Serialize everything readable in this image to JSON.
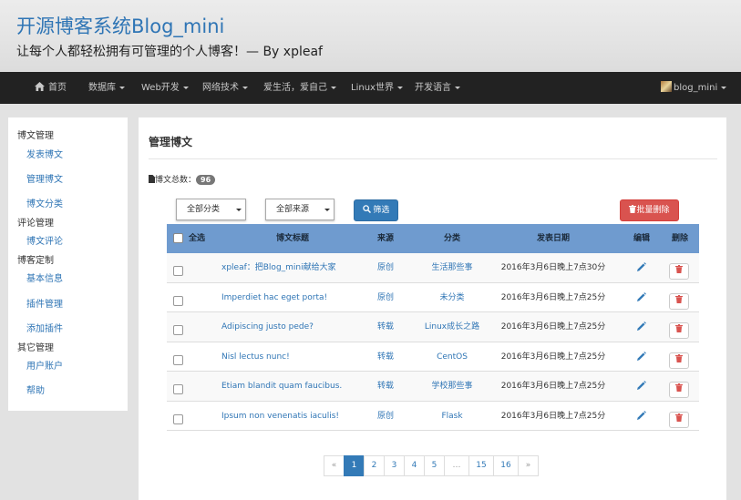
{
  "header": {
    "site_title": "开源博客系统Blog_mini",
    "subtitle": "让每个人都轻松拥有可管理的个人博客！— By xpleaf"
  },
  "navbar": {
    "home": "首页",
    "items": [
      "数据库",
      "Web开发",
      "网络技术",
      "爱生活，爱自己",
      "Linux世界",
      "开发语言"
    ],
    "user": "blog_mini"
  },
  "sidebar": {
    "blog_admin": "博文管理",
    "publish_post": "发表博文",
    "manage_posts": "管理博文",
    "post_categories": "博文分类",
    "comment_admin": "评论管理",
    "post_comments": "博文评论",
    "blog_custom": "博客定制",
    "basic_info": "基本信息",
    "plugin_admin": "插件管理",
    "add_plugin": "添加插件",
    "other_admin": "其它管理",
    "user_account": "用户账户",
    "help": "帮助"
  },
  "main": {
    "title": "管理博文",
    "count_label": "博文总数：",
    "count": "96",
    "filter_category": "全部分类",
    "filter_source": "全部来源",
    "filter_button": "筛选",
    "bulk_delete": "批量删除"
  },
  "table": {
    "headers": {
      "select_all": "全选",
      "title": "博文标题",
      "source": "来源",
      "category": "分类",
      "date": "发表日期",
      "edit": "编辑",
      "delete": "删除"
    },
    "rows": [
      {
        "title": "xpleaf：把Blog_mini献给大家",
        "source": "原创",
        "category": "生活那些事",
        "date": "2016年3月6日晚上7点30分"
      },
      {
        "title": "Imperdiet hac eget porta!",
        "source": "原创",
        "category": "未分类",
        "date": "2016年3月6日晚上7点25分"
      },
      {
        "title": "Adipiscing justo pede?",
        "source": "转载",
        "category": "Linux成长之路",
        "date": "2016年3月6日晚上7点25分"
      },
      {
        "title": "Nisl lectus nunc!",
        "source": "转载",
        "category": "CentOS",
        "date": "2016年3月6日晚上7点25分"
      },
      {
        "title": "Etiam blandit quam faucibus.",
        "source": "转载",
        "category": "学校那些事",
        "date": "2016年3月6日晚上7点25分"
      },
      {
        "title": "Ipsum non venenatis iaculis!",
        "source": "原创",
        "category": "Flask",
        "date": "2016年3月6日晚上7点25分"
      }
    ]
  },
  "pagination": {
    "prev": "«",
    "pages": [
      "1",
      "2",
      "3",
      "4",
      "5",
      "…",
      "15",
      "16"
    ],
    "next": "»",
    "current": "1"
  },
  "colors": {
    "accent": "#337ab7",
    "danger": "#d9534f",
    "navbar": "#222222",
    "table_header": "#6f9bcf"
  }
}
